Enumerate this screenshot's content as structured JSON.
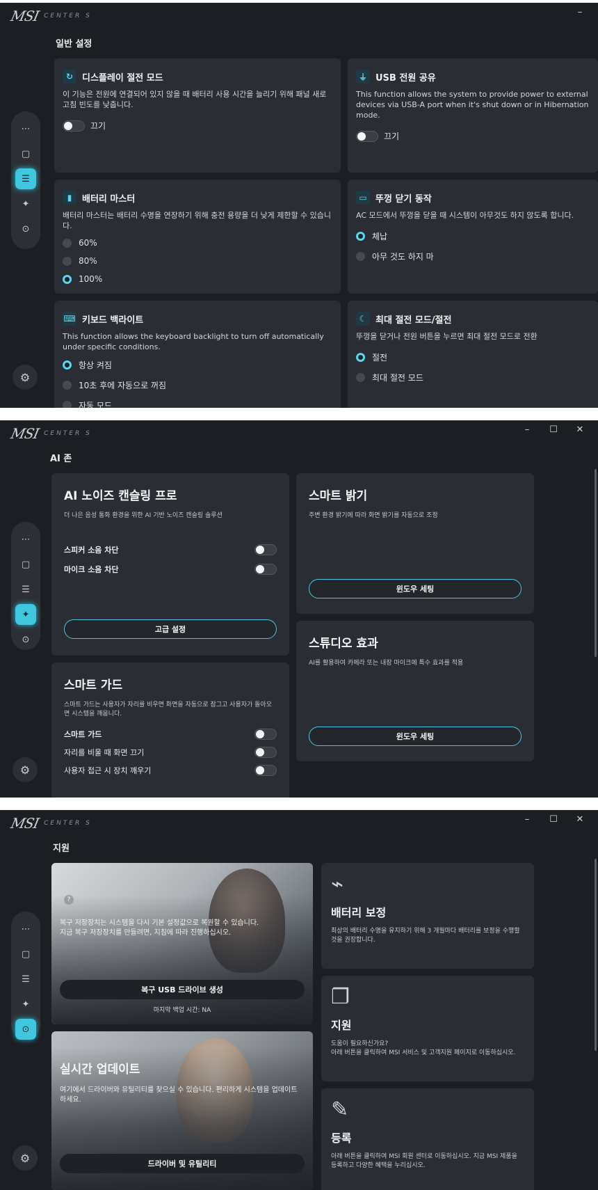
{
  "app": {
    "logo_mark": "MSI",
    "logo_sub": "CENTER S"
  },
  "window_controls": {
    "minimize": "–",
    "maximize": "☐",
    "close": "✕"
  },
  "screen1": {
    "section_title": "일반 설정",
    "nav_icons": [
      "apps-icon",
      "device-icon",
      "settings-sliders-icon",
      "ai-sparkle-icon",
      "support-icon"
    ],
    "cards": {
      "display_power": {
        "title": "디스플레이 절전 모드",
        "desc": "이 기능은 전원에 연결되어 있지 않을 때 배터리 사용 시간을 늘리기 위해 패널 새로 고침 빈도를 낮춥니다.",
        "toggle_label": "끄기"
      },
      "usb_power": {
        "title": "USB 전원 공유",
        "desc": "This function allows the system to provide power to external devices via USB-A port when it's shut down or in Hibernation mode.",
        "toggle_label": "끄기"
      },
      "battery_master": {
        "title": "배터리 마스터",
        "desc": "배터리 마스터는 배터리 수명을 연장하기 위해 충전 용량을 더 낮게 제한할 수 있습니다.",
        "options": [
          "60%",
          "80%",
          "100%"
        ],
        "selected": "100%"
      },
      "lid_close": {
        "title": "뚜껑 닫기 동작",
        "desc": "AC 모드에서 뚜껑을 닫을 때 시스템이 아무것도 하지 않도록 합니다.",
        "options": [
          "체납",
          "아무 것도 하지 마"
        ],
        "selected": "체납"
      },
      "kb_backlight": {
        "title": "키보드 백라이트",
        "desc": "This function allows the keyboard backlight to turn off automatically under specific conditions.",
        "options": [
          "항상 켜짐",
          "10초 후에 자동으로 꺼짐",
          "자동 모드"
        ],
        "selected": "항상 켜짐"
      },
      "sleep_mode": {
        "title": "최대 절전 모드/절전",
        "desc": "뚜껑을 닫거나 전원 버튼을 누르면 최대 절전 모드로 전환",
        "options": [
          "절전",
          "최대 절전 모드"
        ],
        "selected": "절전"
      }
    }
  },
  "screen2": {
    "section_title": "AI 존",
    "noise": {
      "title": "AI 노이즈 캔슬링 프로",
      "desc": "더 나은 음성 통화 환경을 위한 AI 기반 노이즈 캔슬링 솔루션",
      "rows": [
        "스피커 소음 차단",
        "마이크 소음 차단"
      ],
      "button": "고급 설정"
    },
    "brightness": {
      "title": "스마트 밝기",
      "desc": "주변 환경 밝기에 따라 화면 밝기를 자동으로 조정",
      "button": "윈도우 세팅"
    },
    "studio": {
      "title": "스튜디오 효과",
      "desc": "AI를 활용하여 카메라 또는 내장 마이크에 특수 효과를 적용",
      "button": "윈도우 세팅"
    },
    "guard": {
      "title": "스마트 가드",
      "desc": "스마트 가드는 사용자가 자리를 비우면 화면을 자동으로 잠그고 사용자가 돌아오면 시스템을 깨웁니다.",
      "rows": [
        "스마트 가드",
        "자리를 비울 때 화면 끄기",
        "사용자 접근 시 장치 깨우기"
      ]
    }
  },
  "screen3": {
    "section_title": "지원",
    "recovery": {
      "desc": "복구 저장장치는 시스템을 다시 기본 설정값으로 복원할 수 있습니다.\n지금 복구 저장장치를 만들려면, 지침에 따라 진행하십시오.",
      "button": "복구 USB 드라이브 생성",
      "last_backup": "마지막 백업 시간: NA",
      "help": "?"
    },
    "live_update": {
      "title": "실시간 업데이트",
      "desc": "여기에서 드라이버와 유틸리티를 찾으실 수 있습니다. 편리하게 시스템을 업데이트하세요.",
      "button": "드라이버 및 유틸리티"
    },
    "battery_cal": {
      "title": "배터리 보정",
      "desc": "최상의 배터리 수명을 유지하기 위해 3 개월마다 배터리를 보정을 수행할 것을 권장합니다."
    },
    "support": {
      "title": "지원",
      "desc": "도움이 필요하신가요?\n아래 버튼을 클릭하여 MSI 서비스 및 고객지원 페이지로 이동하십시오."
    },
    "register": {
      "title": "등록",
      "desc": "아래 버튼을 클릭하여 MSI 회원 센터로 이동하십시오. 지금 MSI 제품을 등록하고 다양한 혜택을 누리십시오."
    }
  },
  "colors": {
    "accent": "#3ec7df",
    "bg": "#1b1e22",
    "card": "#2a2e34"
  }
}
